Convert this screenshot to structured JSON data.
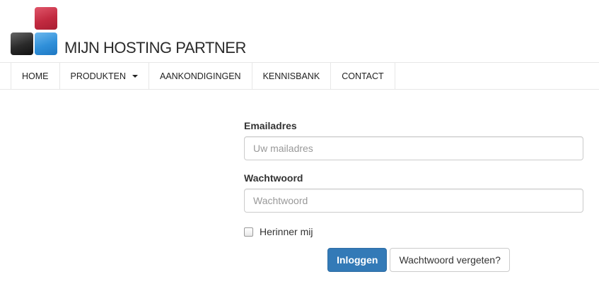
{
  "brand": {
    "name": "MIJN HOSTING PARTNER",
    "colors": {
      "red": "#c22a40",
      "black": "#2a2a2a",
      "blue": "#2f8fd9"
    }
  },
  "nav": {
    "items": [
      {
        "label": "HOME"
      },
      {
        "label": "PRODUKTEN",
        "has_dropdown": true,
        "icon": "caret-down-icon"
      },
      {
        "label": "AANKONDIGINGEN"
      },
      {
        "label": "KENNISBANK"
      },
      {
        "label": "CONTACT"
      }
    ]
  },
  "login": {
    "email_label": "Emailadres",
    "email_placeholder": "Uw mailadres",
    "email_value": "",
    "password_label": "Wachtwoord",
    "password_placeholder": "Wachtwoord",
    "password_value": "",
    "remember_label": "Herinner mij",
    "remember_checked": false,
    "submit_label": "Inloggen",
    "forgot_label": "Wachtwoord vergeten?"
  },
  "colors": {
    "primary": "#337ab7",
    "border": "#cccccc"
  }
}
